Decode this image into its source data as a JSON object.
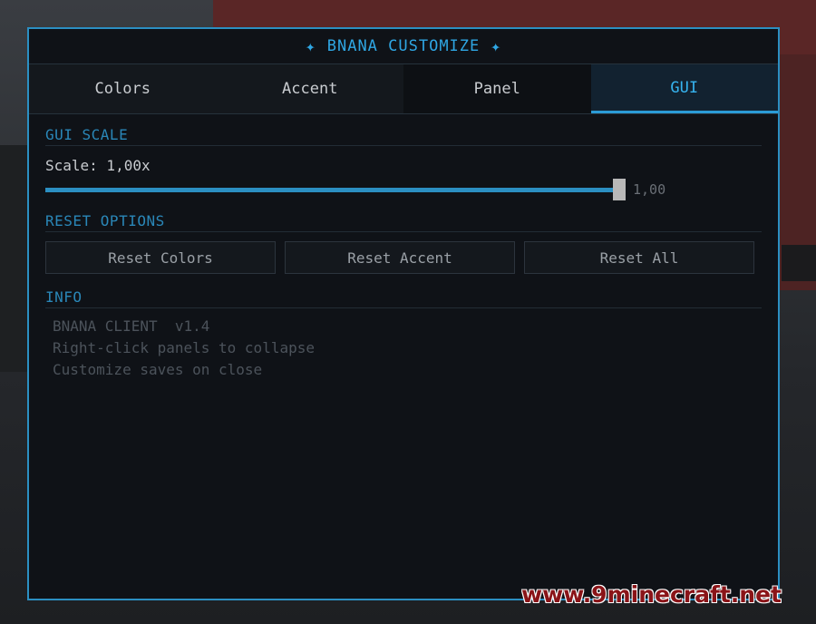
{
  "window": {
    "title": "BNANA CUSTOMIZE"
  },
  "tabs": [
    {
      "label": "Colors"
    },
    {
      "label": "Accent"
    },
    {
      "label": "Panel"
    },
    {
      "label": "GUI",
      "active": true
    }
  ],
  "gui_scale": {
    "section_title": "GUI SCALE",
    "scale_label": "Scale: 1,00x",
    "slider_value_text": "1,00",
    "slider_fraction": 0.98
  },
  "reset_options": {
    "section_title": "RESET OPTIONS",
    "buttons": [
      {
        "label": "Reset Colors"
      },
      {
        "label": "Reset Accent"
      },
      {
        "label": "Reset All"
      }
    ]
  },
  "info": {
    "section_title": "INFO",
    "lines": [
      "BNANA CLIENT  v1.4",
      "Right-click panels to collapse",
      "Customize saves on close"
    ]
  },
  "watermark": "www.9minecraft.net",
  "colors": {
    "accent": "#2b8fc2",
    "panel_bg": "#0f1217"
  }
}
